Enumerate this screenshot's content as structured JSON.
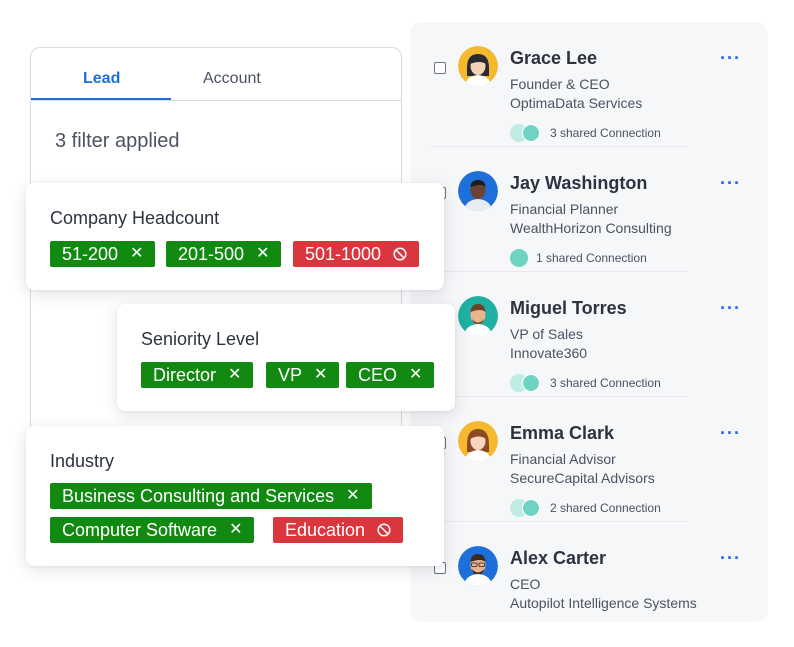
{
  "filter_panel": {
    "tabs": [
      {
        "label": "Lead",
        "active": true
      },
      {
        "label": "Account",
        "active": false
      }
    ],
    "filter_count": "3 filter applied"
  },
  "filters": {
    "headcount": {
      "label": "Company Headcount",
      "chips": [
        {
          "text": "51-200",
          "type": "include"
        },
        {
          "text": "201-500",
          "type": "include"
        },
        {
          "text": "501-1000",
          "type": "exclude"
        }
      ]
    },
    "seniority": {
      "label": "Seniority Level",
      "chips": [
        {
          "text": "Director",
          "type": "include"
        },
        {
          "text": "VP",
          "type": "include"
        },
        {
          "text": "CEO",
          "type": "include"
        }
      ]
    },
    "industry": {
      "label": "Industry",
      "chips": [
        {
          "text": "Business Consulting and Services",
          "type": "include"
        },
        {
          "text": "Computer Software",
          "type": "include"
        },
        {
          "text": "Education",
          "type": "exclude"
        }
      ]
    }
  },
  "leads": [
    {
      "name": "Grace Lee",
      "title": "Founder & CEO",
      "company": "OptimaData Services",
      "connections": "3 shared Connection",
      "avatar_bg": "#f5b82e",
      "avatar_icon": "woman-avatar"
    },
    {
      "name": "Jay Washington",
      "title": "Financial Planner",
      "company": "WealthHorizon Consulting",
      "connections": "1 shared Connection",
      "avatar_bg": "#1e6fd9",
      "avatar_icon": "man-avatar"
    },
    {
      "name": "Miguel Torres",
      "title": "VP of Sales",
      "company": "Innovate360",
      "connections": "3 shared Connection",
      "avatar_bg": "#1fb0a3",
      "avatar_icon": "man-avatar"
    },
    {
      "name": "Emma Clark",
      "title": "Financial Advisor",
      "company": "SecureCapital Advisors",
      "connections": "2 shared Connection",
      "avatar_bg": "#f5b82e",
      "avatar_icon": "woman-avatar"
    },
    {
      "name": "Alex Carter",
      "title": "CEO",
      "company": "Autopilot Intelligence Systems",
      "connections": "",
      "avatar_bg": "#1e6fd9",
      "avatar_icon": "man-avatar"
    }
  ],
  "more_label": "···",
  "colors": {
    "include_chip": "#128a12",
    "exclude_chip": "#d9363e",
    "accent": "#1e6fd9",
    "connection_dot": "#6fd3c4"
  }
}
